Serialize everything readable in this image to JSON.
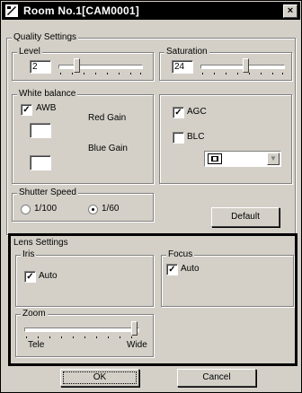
{
  "window": {
    "title": "Room No.1[CAM0001]",
    "close_glyph": "×"
  },
  "quality": {
    "group_label": "Quality Settings",
    "level": {
      "label": "Level",
      "value": "2",
      "position": 0.2
    },
    "saturation": {
      "label": "Saturation",
      "value": "24",
      "position": 0.55
    }
  },
  "white_balance": {
    "label": "White balance",
    "awb_label": "AWB",
    "awb_checked": true,
    "red_gain_label": "Red Gain",
    "red_gain_value": "",
    "blue_gain_label": "Blue Gain",
    "blue_gain_value": ""
  },
  "agc_blc": {
    "agc_label": "AGC",
    "agc_checked": true,
    "blc_label": "BLC",
    "blc_checked": false
  },
  "shutter": {
    "label": "Shutter Speed",
    "options": [
      {
        "label": "1/100",
        "selected": false
      },
      {
        "label": "1/60",
        "selected": true
      }
    ]
  },
  "default_button": "Default",
  "lens": {
    "label": "Lens Settings",
    "iris": {
      "label": "Iris",
      "auto_label": "Auto",
      "auto_checked": true
    },
    "focus": {
      "label": "Focus",
      "auto_label": "Auto",
      "auto_checked": true
    },
    "zoom": {
      "label": "Zoom",
      "left_label": "Tele",
      "right_label": "Wide",
      "position": 1.0
    }
  },
  "ok_button": "OK",
  "cancel_button": "Cancel",
  "check_glyph": "✓"
}
